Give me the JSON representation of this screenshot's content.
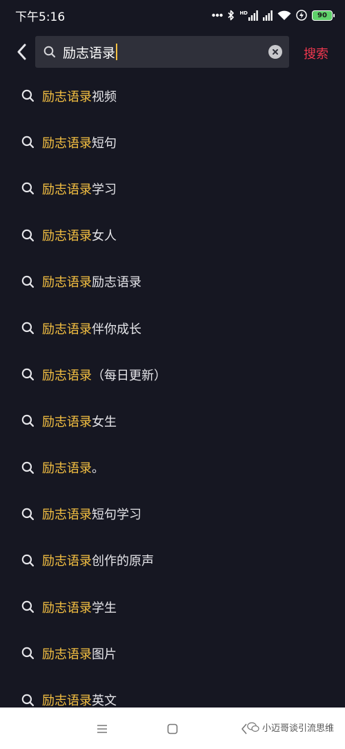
{
  "status_bar": {
    "time": "下午5:16",
    "network": "HD",
    "battery": "90"
  },
  "search": {
    "query": "励志语录",
    "submit_label": "搜索"
  },
  "suggestions": [
    {
      "highlight": "励志语录",
      "rest": "视频"
    },
    {
      "highlight": "励志语录",
      "rest": "短句"
    },
    {
      "highlight": "励志语录",
      "rest": "学习"
    },
    {
      "highlight": "励志语录",
      "rest": "女人"
    },
    {
      "highlight": "励志语录",
      "rest": "励志语录"
    },
    {
      "highlight": "励志语录",
      "rest": "伴你成长"
    },
    {
      "highlight": "励志语录",
      "rest": "（每日更新）"
    },
    {
      "highlight": "励志语录",
      "rest": "女生"
    },
    {
      "highlight": "励志语录",
      "rest": "。"
    },
    {
      "highlight": "励志语录",
      "rest": "短句学习"
    },
    {
      "highlight": "励志语录",
      "rest": "创作的原声"
    },
    {
      "highlight": "励志语录",
      "rest": "学生"
    },
    {
      "highlight": "励志语录",
      "rest": "图片"
    },
    {
      "highlight": "励志语录",
      "rest": "英文"
    }
  ],
  "watermark": {
    "text": "小迈哥谈引流思维"
  },
  "icons": {
    "back": "chevron-left-icon",
    "search": "search-icon",
    "clear": "clear-icon",
    "menu": "menu-icon",
    "home": "home-square-icon",
    "nav_back": "nav-back-icon"
  },
  "colors": {
    "background": "#161722",
    "search_box": "#2f303a",
    "highlight": "#f6c142",
    "accent_red": "#f2384f",
    "battery_green": "#5fd16a"
  }
}
